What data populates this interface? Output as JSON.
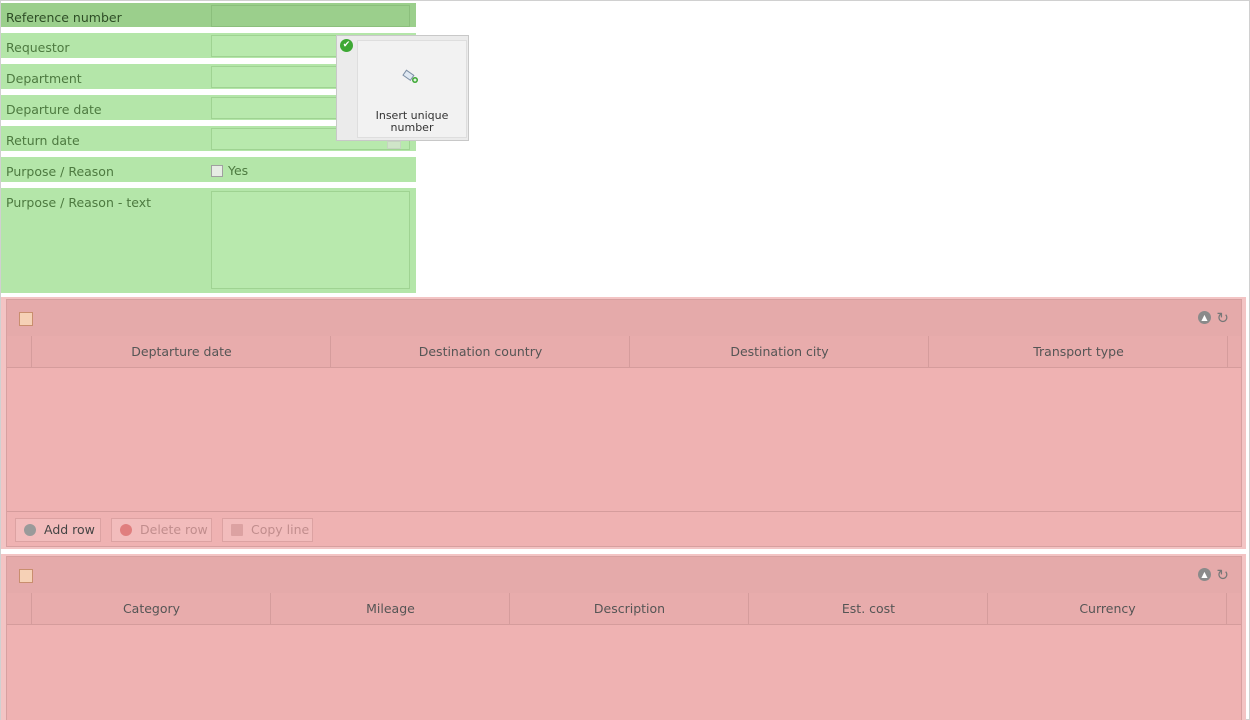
{
  "form": {
    "fields": [
      {
        "label": "Reference number"
      },
      {
        "label": "Requestor"
      },
      {
        "label": "Department"
      },
      {
        "label": "Departure date"
      },
      {
        "label": "Return date"
      },
      {
        "label": "Purpose / Reason",
        "checkbox_label": "Yes"
      },
      {
        "label": "Purpose / Reason - text"
      }
    ]
  },
  "popup": {
    "text": "Insert unique number",
    "icon": "wand-icon"
  },
  "trips_grid": {
    "columns": [
      "Deptarture date",
      "Destination country",
      "Destination city",
      "Transport type"
    ],
    "buttons": {
      "add": "Add row",
      "delete": "Delete row",
      "copy": "Copy line"
    }
  },
  "costs_grid": {
    "columns": [
      "Category",
      "Mileage",
      "Description",
      "Est. cost",
      "Currency"
    ]
  },
  "colors": {
    "form_bg": "#b4e6a9",
    "form_highlight": "#9bcf8c",
    "grid_bg": "#efb2b2"
  }
}
